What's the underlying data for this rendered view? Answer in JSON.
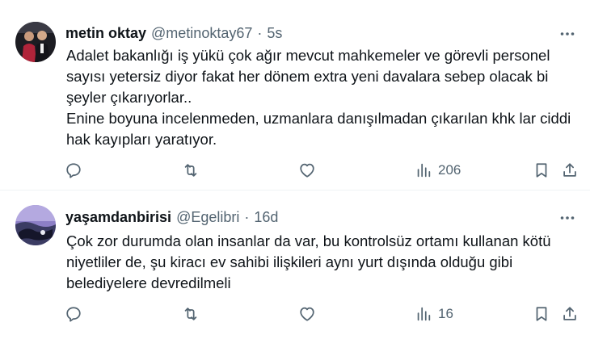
{
  "tweets": [
    {
      "author_name": "metin oktay",
      "handle": "@metinoktay67",
      "separator": "·",
      "time": "5s",
      "lines": [
        "Adalet bakanlığı iş yükü çok ağır mevcut mahkemeler ve görevli personel",
        "sayısı yetersiz diyor fakat her dönem extra yeni davalara sebep olacak bi",
        "şeyler çıkarıyorlar..",
        "Enine boyuna incelenmeden, uzmanlara danışılmadan çıkarılan khk lar ciddi",
        "hak kayıpları yaratıyor."
      ],
      "views": "206",
      "avatar_colors": [
        "#1c1c22",
        "#b0243a"
      ]
    },
    {
      "author_name": "yaşamdanbirisi",
      "handle": "@Egelibri",
      "separator": "·",
      "time": "16d",
      "lines": [
        "Çok zor durumda olan insanlar da var, bu kontrolsüz ortamı kullanan kötü",
        "niyetliler de, şu kiracı ev sahibi ilişkileri aynı yurt dışında olduğu gibi",
        "belediyelere devredilmeli"
      ],
      "views": "16",
      "avatar_colors": [
        "#8c7fc6",
        "#2b2d47"
      ]
    }
  ],
  "icons": [
    "reply-icon",
    "retweet-icon",
    "like-icon",
    "views-icon",
    "bookmark-icon",
    "share-icon",
    "more-icon"
  ],
  "colors": {
    "text": "#0f1419",
    "secondary": "#536471",
    "divider": "#eff3f4"
  }
}
